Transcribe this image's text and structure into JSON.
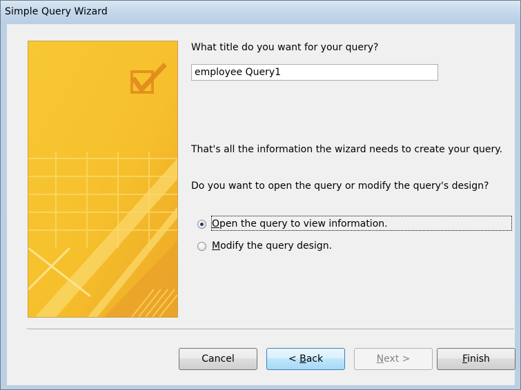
{
  "window": {
    "title": "Simple Query Wizard"
  },
  "wizard": {
    "title_prompt": "What title do you want for your query?",
    "title_value": "employee Query1",
    "info_text": "That's all the information the wizard needs to create your query.",
    "open_prompt": "Do you want to open the query or modify the query's design?",
    "options": [
      {
        "mnemonic": "O",
        "rest": "pen the query to view information.",
        "selected": true
      },
      {
        "mnemonic": "M",
        "rest": "odify the query design.",
        "selected": false
      }
    ]
  },
  "buttons": {
    "cancel": {
      "label": "Cancel",
      "enabled": true
    },
    "back": {
      "prefix": "< ",
      "mnemonic": "B",
      "rest": "ack",
      "enabled": true
    },
    "next": {
      "mnemonic": "N",
      "rest": "ext >",
      "enabled": false
    },
    "finish": {
      "mnemonic": "F",
      "rest": "inish",
      "enabled": true
    }
  },
  "colors": {
    "panel_yellow": "#f6c331",
    "panel_orange": "#e9a32a",
    "checkmark_orange": "#e08a1e",
    "focus_blue": "#3c7fb1"
  },
  "icons": [
    "wizard-checkmark-icon",
    "radio-selected-icon",
    "radio-unselected-icon"
  ]
}
